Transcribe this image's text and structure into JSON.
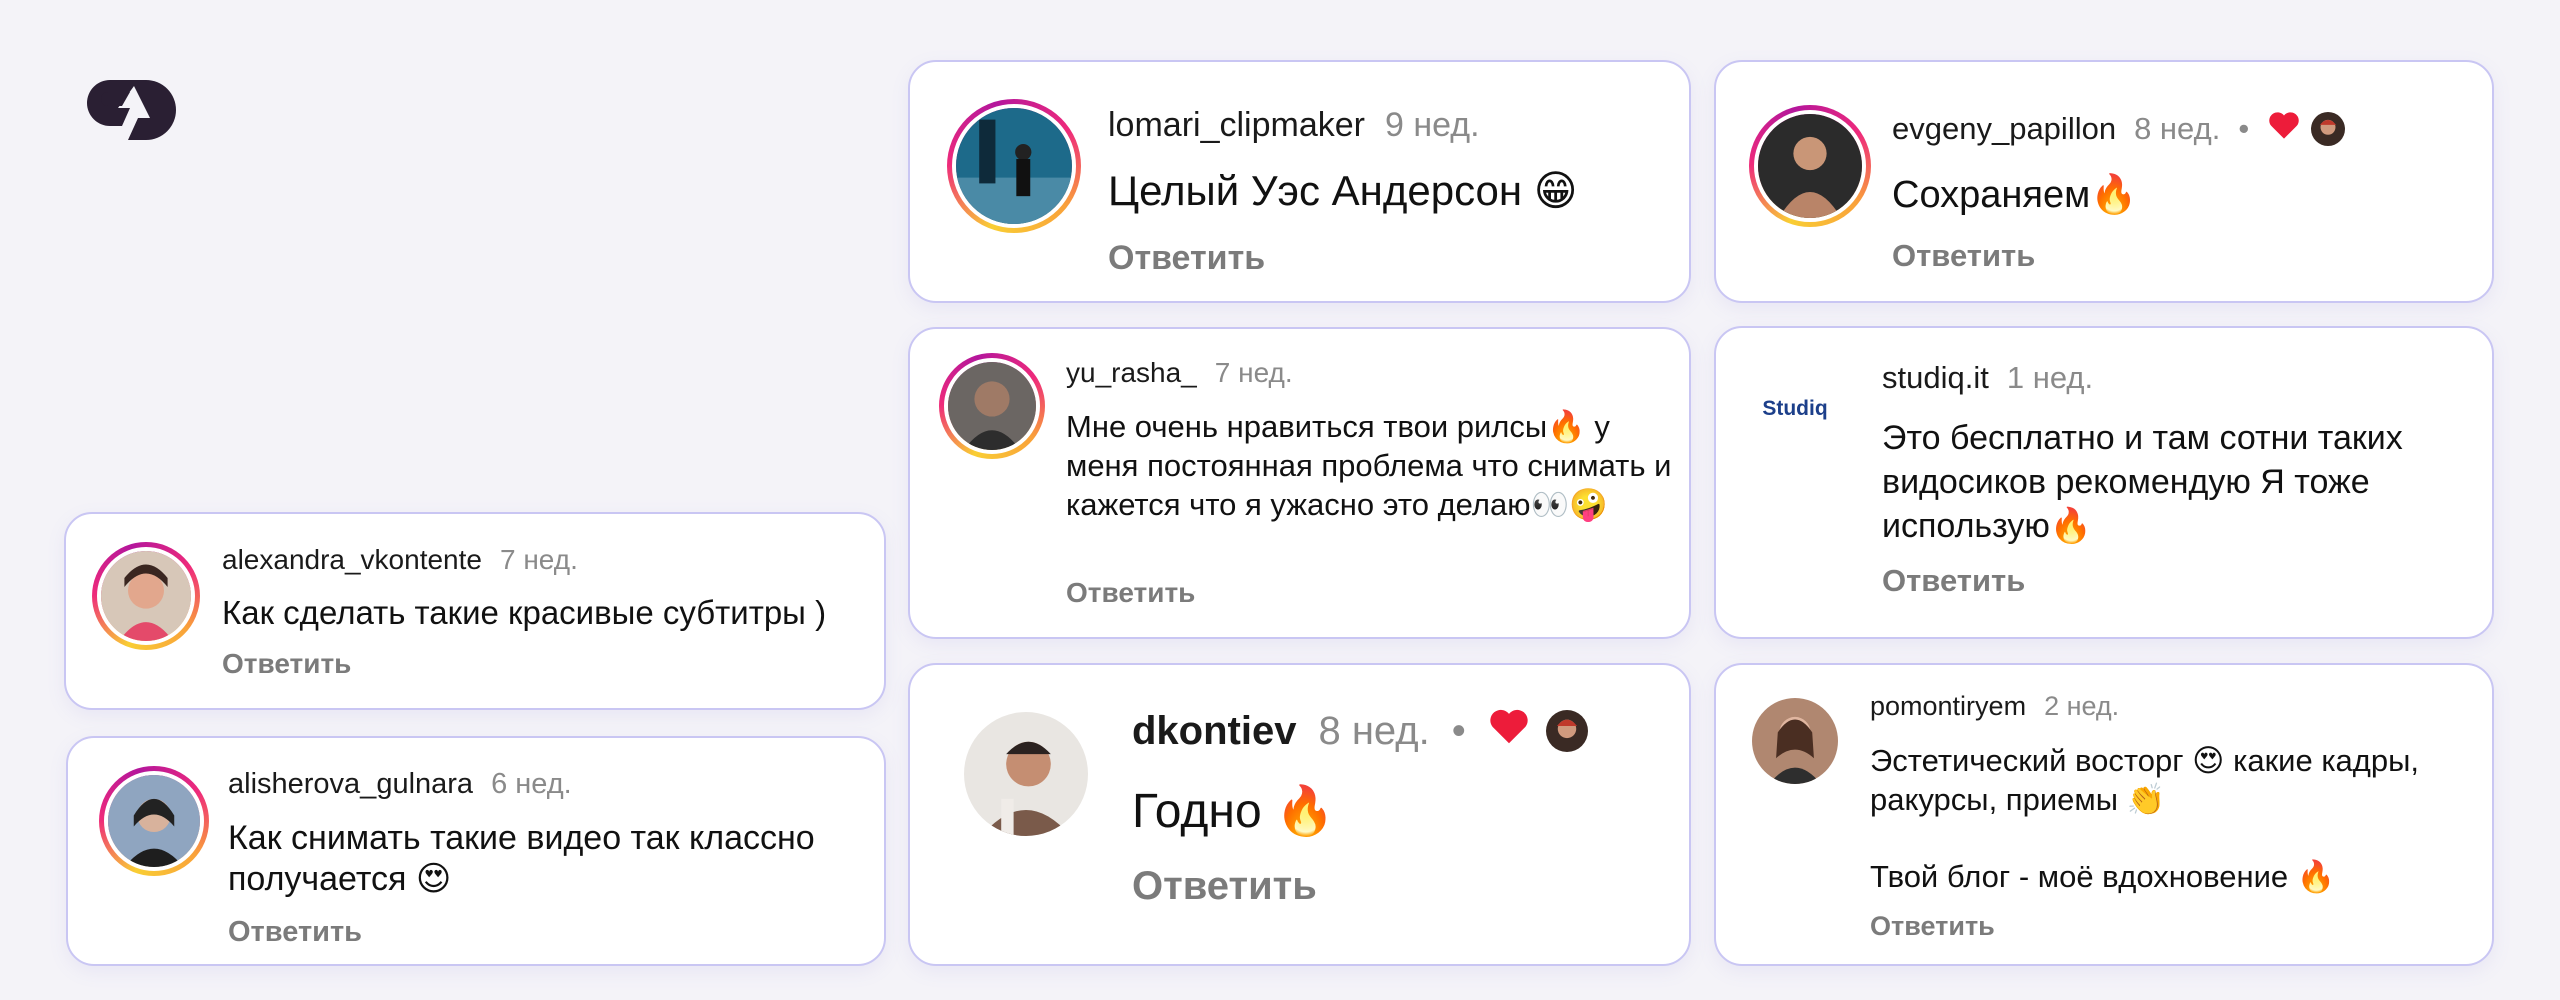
{
  "comments": {
    "c1": {
      "username": "lomari_clipmaker",
      "time": "9 нед.",
      "text": "Целый Уэс Андерсон 😁",
      "reply": "Ответить"
    },
    "c2": {
      "username": "evgeny_papillon",
      "time": "8 нед.",
      "text": "Сохраняем🔥",
      "reply": "Ответить",
      "liked": true
    },
    "c3": {
      "username": "yu_rasha_",
      "time": "7 нед.",
      "text": "Мне очень нравиться твои рилсы🔥 у меня постоянная проблема что снимать и кажется что я ужасно это делаю👀🤪",
      "reply": "Ответить"
    },
    "c4": {
      "username": "studiq.it",
      "time": "1 нед.",
      "text": "Это бесплатно и там сотни таких видосиков рекомендую Я тоже использую🔥",
      "reply": "Ответить",
      "avatar_text": "Studiq"
    },
    "c5": {
      "username": "alexandra_vkontente",
      "time": "7 нед.",
      "text": "Как сделать такие красивые субтитры )",
      "reply": "Ответить"
    },
    "c6": {
      "username": "alisherova_gulnara",
      "time": "6 нед.",
      "text": "Как снимать такие видео так классно получается 😍",
      "reply": "Ответить"
    },
    "c7": {
      "username": "dkontiev",
      "time": "8 нед.",
      "text": "Годно 🔥",
      "reply": "Ответить",
      "liked": true
    },
    "c8": {
      "username": "pomontiryem",
      "time": "2 нед.",
      "text_line1": "Эстетический восторг 😍 какие кадры, ракурсы, приемы 👏",
      "text_line2": "Твой блог - моё вдохновение 🔥",
      "reply": "Ответить"
    }
  },
  "dot": "•",
  "colors": {
    "card_border": "#c9c6f3",
    "heart": "#ed1c3a",
    "logo": "#2a1f33",
    "background": "#f4f3f8"
  }
}
